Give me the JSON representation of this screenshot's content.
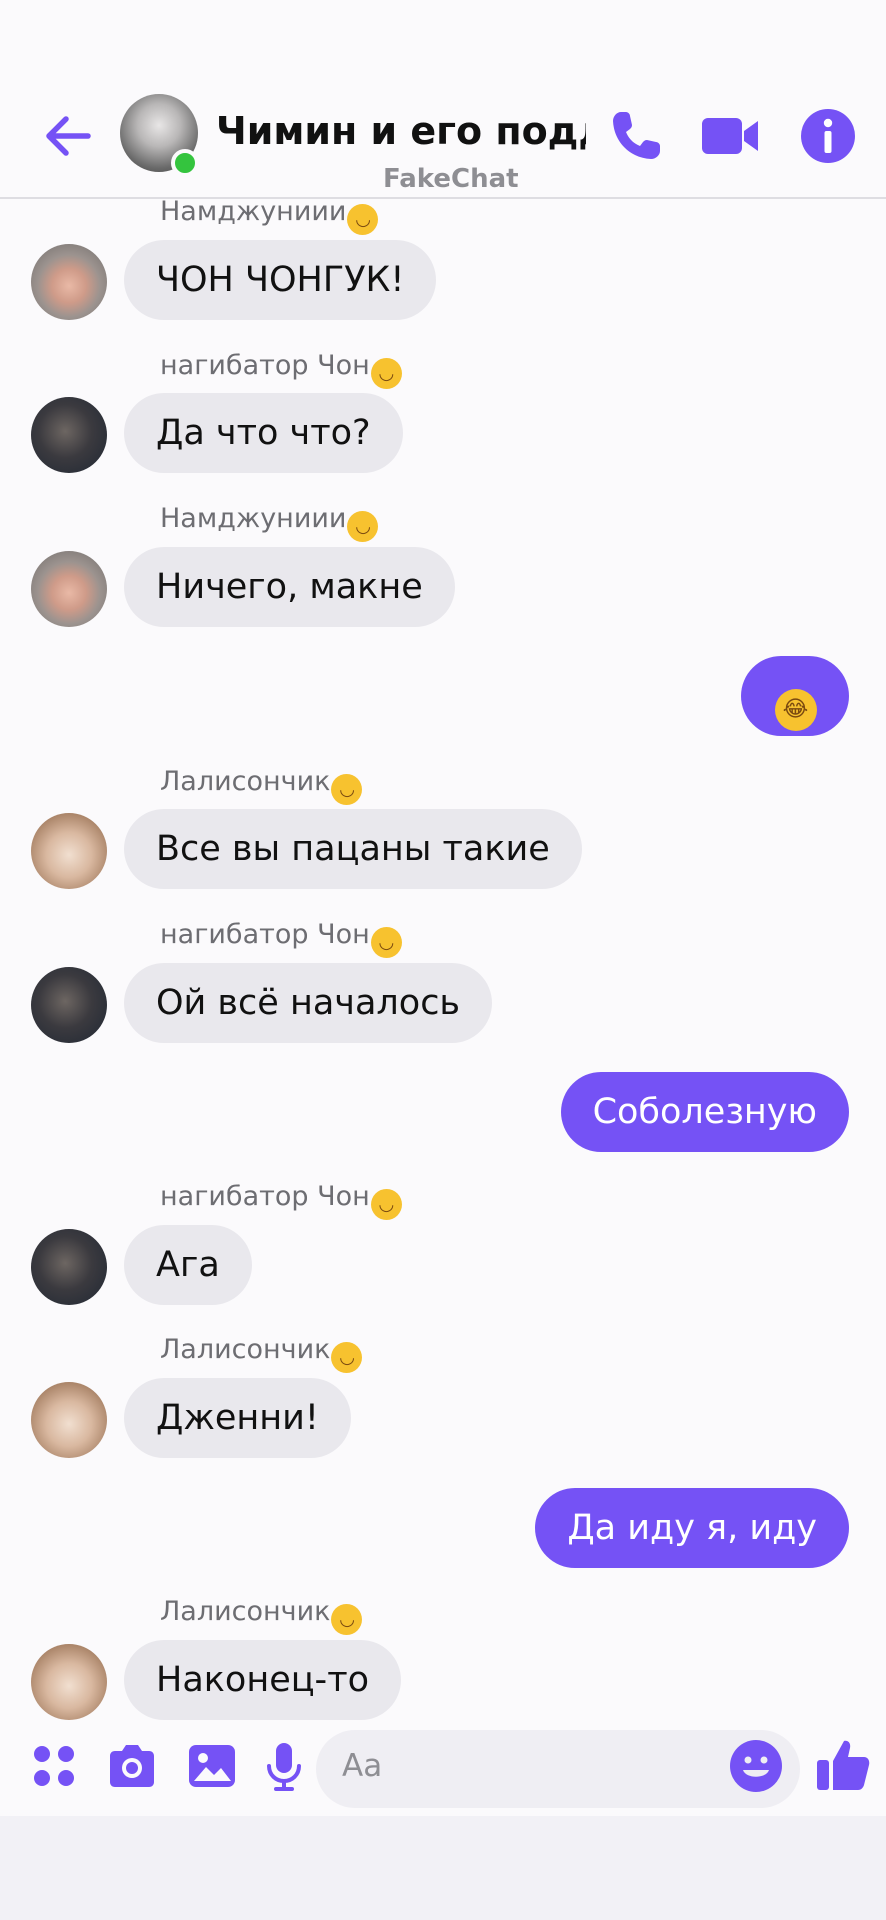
{
  "header": {
    "title": "Чимин и его подд...",
    "subtitle": "FakeChat"
  },
  "colors": {
    "accent": "#7552f5",
    "online": "#34c43e",
    "incoming_bubble": "#e9e8ed"
  },
  "messages": [
    {
      "sender": "Намджуниии",
      "sender_emoji": "🫠",
      "text": "ЧОН ЧОНГУК!"
    },
    {
      "sender": "нагибатор Чон",
      "sender_emoji": "😉",
      "text": "Да что что?"
    },
    {
      "sender": "Намджуниии",
      "sender_emoji": "🫠",
      "text": "Ничего, макне"
    },
    {
      "sender": "",
      "text": "😂"
    },
    {
      "sender": "Лалисончик",
      "sender_emoji": "😙",
      "text": "Все вы пацаны такие"
    },
    {
      "sender": "нагибатор Чон",
      "sender_emoji": "😉",
      "text": "Ой всё началось"
    },
    {
      "sender": "",
      "text": "Соболезную"
    },
    {
      "sender": "нагибатор Чон",
      "sender_emoji": "😉",
      "text": "Ага"
    },
    {
      "sender": "Лалисончик",
      "sender_emoji": "😙",
      "text": "Дженни!"
    },
    {
      "sender": "",
      "text": "Да иду я, иду"
    },
    {
      "sender": "Лалисончик",
      "sender_emoji": "😙",
      "text": "Наконец-то"
    }
  ],
  "composer": {
    "placeholder": "Aa"
  },
  "icons": {
    "back": "arrow-left-icon",
    "call": "phone-icon",
    "video": "video-camera-icon",
    "info": "info-icon",
    "apps": "apps-grid-icon",
    "camera": "camera-icon",
    "gallery": "image-icon",
    "mic": "microphone-icon",
    "emoji": "smiley-icon",
    "like": "thumbs-up-icon"
  }
}
